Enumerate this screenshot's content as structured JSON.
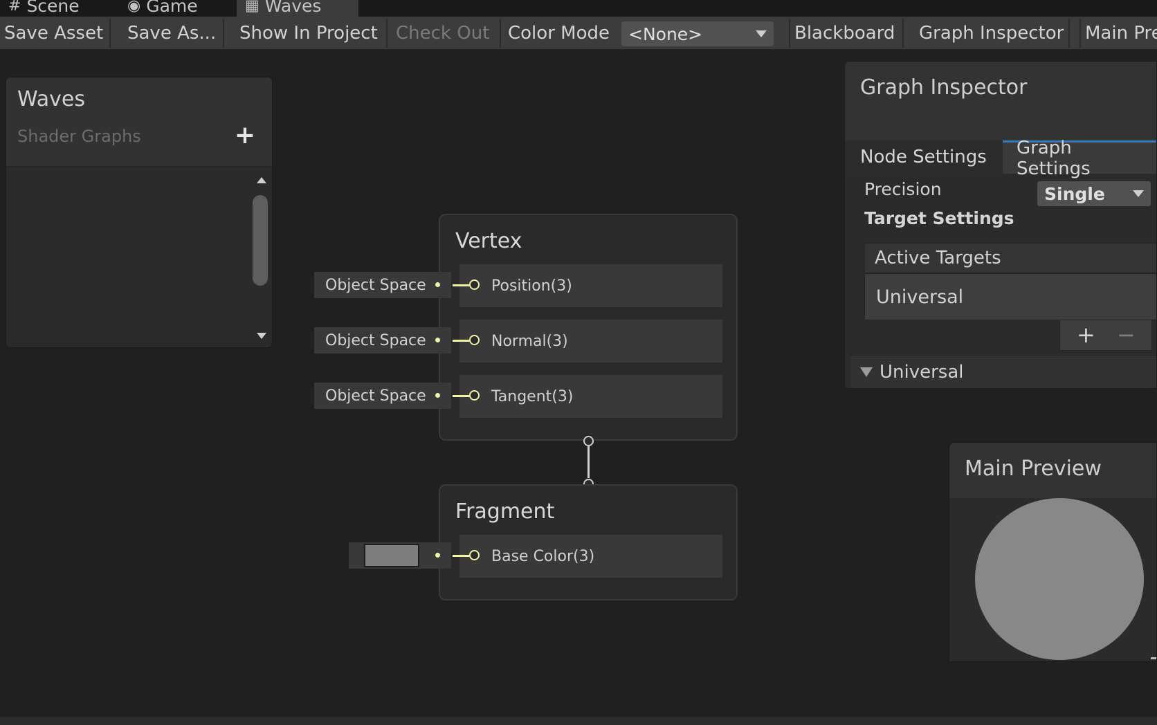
{
  "tabs": [
    {
      "label": "Scene",
      "icon": "grid-hash-icon"
    },
    {
      "label": "Game",
      "icon": "gamepad-icon"
    },
    {
      "label": "Waves",
      "icon": "shader-graph-icon"
    }
  ],
  "toolbar": {
    "save_asset": "Save Asset",
    "save_as": "Save As...",
    "show_in_project": "Show In Project",
    "check_out": "Check Out",
    "color_mode_label": "Color Mode",
    "color_mode_value": "<None>",
    "blackboard": "Blackboard",
    "graph_inspector": "Graph Inspector",
    "main_preview": "Main Preview"
  },
  "blackboard": {
    "title": "Waves",
    "subtitle": "Shader Graphs",
    "add_symbol": "+"
  },
  "vertex": {
    "title": "Vertex",
    "slots": [
      {
        "input": "Object Space",
        "label": "Position(3)"
      },
      {
        "input": "Object Space",
        "label": "Normal(3)"
      },
      {
        "input": "Object Space",
        "label": "Tangent(3)"
      }
    ]
  },
  "fragment": {
    "title": "Fragment",
    "slots": [
      {
        "label": "Base Color(3)",
        "swatch_color": "#7d7d7d"
      }
    ]
  },
  "inspector": {
    "title": "Graph Inspector",
    "tabs": [
      {
        "label": "Node Settings",
        "active": false
      },
      {
        "label": "Graph Settings",
        "active": true
      }
    ],
    "precision_label": "Precision",
    "precision_value": "Single",
    "target_settings": "Target Settings",
    "active_targets": "Active Targets",
    "targets": [
      "Universal"
    ],
    "add": "+",
    "remove": "−",
    "section": "Universal"
  },
  "preview": {
    "title": "Main Preview"
  },
  "colors": {
    "accent": "#3a79bb",
    "port": "#f1f3a6",
    "background": "#202020"
  }
}
